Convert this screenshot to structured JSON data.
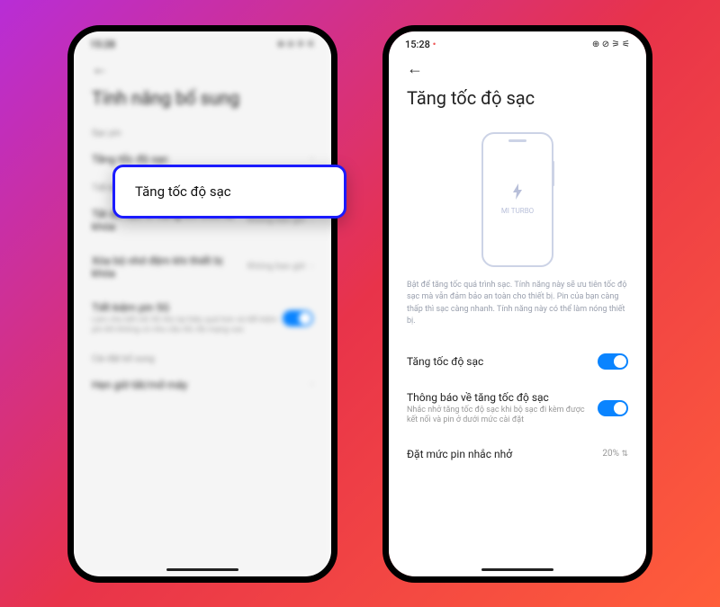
{
  "statusbar": {
    "time": "15:28",
    "dot": "•",
    "indicators": "⊕ ⊘ ⚞ ⚟"
  },
  "left": {
    "title": "Tính năng bổ sung",
    "section1": "Sạc pin",
    "highlight": "Tăng tốc độ sạc",
    "section2": "Tiết kiệm pin",
    "row1_label": "Tắt dữ liệu di động khi thiết bị khóa",
    "row1_value": "Không bao giờ",
    "row2_label": "Xóa bộ nhớ đệm khi thiết bị khóa",
    "row2_value": "Không bao giờ",
    "row3_label": "Tiết kiệm pin 5G",
    "row3_sub": "Làm cho kết nối 5G tồn tại hiệu quả hơn và tiết kiệm pin khi không có nhu cầu tốc độ mạng cao",
    "section3": "Cài đặt bổ sung",
    "row4_label": "Hẹn giờ tắt/mở máy"
  },
  "right": {
    "title": "Tăng tốc độ sạc",
    "illus_caption": "MI TURBO",
    "description": "Bật để tăng tốc quá trình sạc. Tính năng này sẽ ưu tiên tốc độ sạc mà vẫn đảm bảo an toàn cho thiết bị. Pin của bạn càng thấp thì sạc càng nhanh. Tính năng này có thể làm nóng thiết bị.",
    "row1_label": "Tăng tốc độ sạc",
    "row2_label": "Thông báo về tăng tốc độ sạc",
    "row2_sub": "Nhắc nhở tăng tốc độ sạc khi bộ sạc đi kèm được kết nối và pin ở dưới mức cài đặt",
    "row3_label": "Đặt mức pin nhắc nhở",
    "row3_value": "20%"
  }
}
